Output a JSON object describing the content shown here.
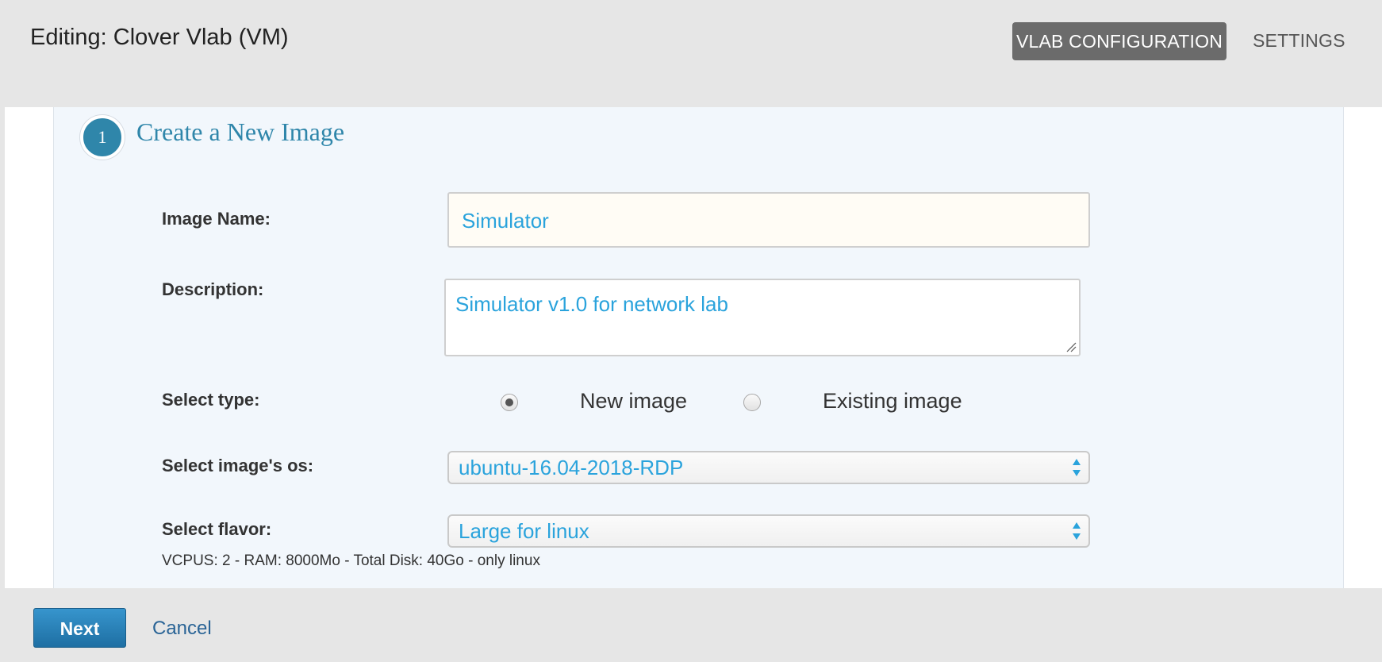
{
  "header": {
    "title": "Editing: Clover Vlab (VM)",
    "tabs": [
      {
        "label": "VLAB CONFIGURATION",
        "active": true
      },
      {
        "label": "SETTINGS",
        "active": false
      }
    ]
  },
  "step": {
    "number": "1",
    "title": "Create a New Image"
  },
  "form": {
    "image_name": {
      "label": "Image Name:",
      "value": "Simulator"
    },
    "description": {
      "label": "Description:",
      "value": "Simulator v1.0 for network lab"
    },
    "select_type": {
      "label": "Select type:",
      "options": [
        {
          "label": "New image",
          "checked": true
        },
        {
          "label": "Existing image",
          "checked": false
        }
      ]
    },
    "image_os": {
      "label": "Select image's os:",
      "selected": "ubuntu-16.04-2018-RDP"
    },
    "flavor": {
      "label": "Select flavor:",
      "selected": "Large for linux",
      "info": "VCPUS: 2 - RAM: 8000Mo - Total Disk: 40Go - only linux"
    }
  },
  "footer": {
    "next_label": "Next",
    "cancel_label": "Cancel"
  },
  "colors": {
    "accent": "#2f86aa",
    "input_text": "#2aa3dc",
    "primary_button": "#2a80b9",
    "active_tab": "#6b6b6b"
  },
  "icons": [
    "select-arrows-icon",
    "resize-handle-icon",
    "radio-icon"
  ]
}
